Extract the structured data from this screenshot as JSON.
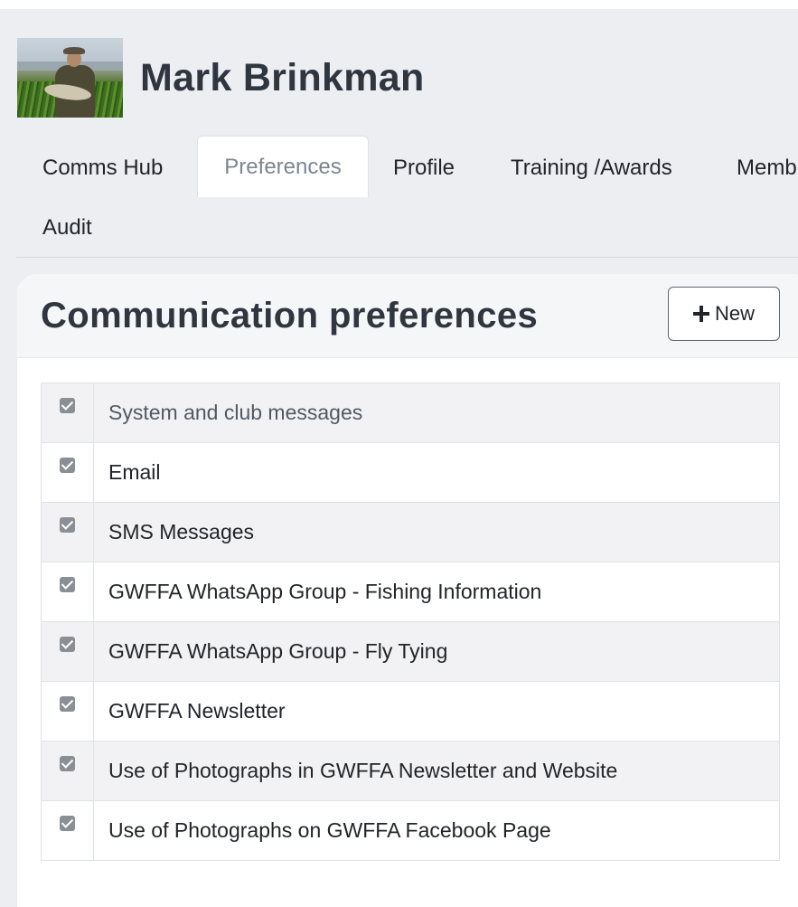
{
  "profile": {
    "name": "Mark Brinkman"
  },
  "tabs": [
    {
      "label": "Comms Hub",
      "active": false
    },
    {
      "label": "Preferences",
      "active": true
    },
    {
      "label": "Profile",
      "active": false
    },
    {
      "label": "Training /Awards",
      "active": false
    },
    {
      "label": "Memb",
      "active": false
    },
    {
      "label": "Audit",
      "active": false
    }
  ],
  "card": {
    "title": "Communication preferences",
    "new_button_label": "New"
  },
  "preferences": [
    {
      "label": "System and club messages",
      "checked": true
    },
    {
      "label": "Email",
      "checked": true
    },
    {
      "label": "SMS Messages",
      "checked": true
    },
    {
      "label": "GWFFA WhatsApp Group - Fishing Information",
      "checked": true
    },
    {
      "label": "GWFFA WhatsApp Group - Fly Tying",
      "checked": true
    },
    {
      "label": "GWFFA Newsletter",
      "checked": true
    },
    {
      "label": "Use of Photographs in GWFFA Newsletter and Website",
      "checked": true
    },
    {
      "label": "Use of Photographs on GWFFA Facebook Page",
      "checked": true
    }
  ],
  "colors": {
    "page_background": "#eceef1",
    "card_background": "#ffffff",
    "checkbox": "#8a8f95",
    "heading": "#2f3640"
  }
}
